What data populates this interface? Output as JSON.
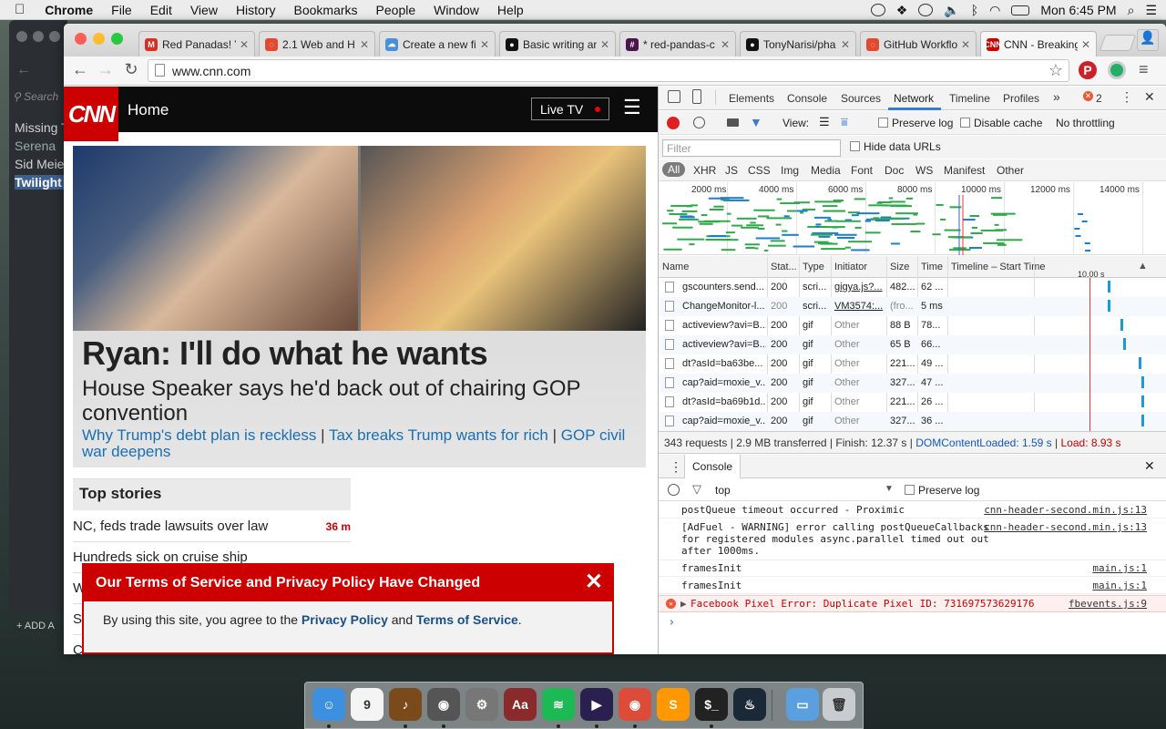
{
  "menubar": {
    "apple": "",
    "app": "Chrome",
    "items": [
      "File",
      "Edit",
      "View",
      "History",
      "Bookmarks",
      "People",
      "Window",
      "Help"
    ],
    "clock": "Mon 6:45 PM"
  },
  "bg_app": {
    "search_placeholder": "Search",
    "items": [
      "Missing T",
      "Serena",
      "Sid Meier",
      "Twilight S"
    ],
    "add_label": "ADD A"
  },
  "tabs": [
    {
      "title": "Red Panadas! Y",
      "icon": "gmail-icon",
      "color": "#d93025",
      "glyph": "M"
    },
    {
      "title": "2.1 Web and H",
      "icon": "loading-ring-icon",
      "color": "#e04a2f",
      "glyph": "◌"
    },
    {
      "title": "Create a new fi",
      "icon": "cloud-icon",
      "color": "#4a90d9",
      "glyph": "☁"
    },
    {
      "title": "Basic writing an",
      "icon": "github-icon",
      "color": "#111",
      "glyph": "●"
    },
    {
      "title": "* red-pandas-c",
      "icon": "slack-icon",
      "color": "#4a154b",
      "glyph": "#"
    },
    {
      "title": "TonyNarisi/pha",
      "icon": "github-icon",
      "color": "#111",
      "glyph": "●"
    },
    {
      "title": "GitHub Workflo",
      "icon": "loading-ring-icon",
      "color": "#e04a2f",
      "glyph": "◌"
    },
    {
      "title": "CNN - Breaking",
      "icon": "cnn-icon",
      "color": "#cc0000",
      "glyph": "CNN",
      "active": true
    }
  ],
  "address": {
    "url": "www.cnn.com"
  },
  "cnn": {
    "logo": "CNN",
    "nav_title": "Home",
    "live_tv": "Live TV",
    "headline": "Ryan: I'll do what he wants",
    "subhead": "House Speaker says he'd back out of chairing GOP convention",
    "links": [
      "Why Trump's debt plan is reckless",
      "Tax breaks Trump wants for rich",
      "GOP civil war deepens"
    ],
    "link_sep": "|",
    "top_stories_title": "Top stories",
    "stories": [
      {
        "text": "NC, feds trade lawsuits over law",
        "age": "36 m"
      },
      {
        "text": "Hundreds sick on cruise ship",
        "age": ""
      },
      {
        "text": "W",
        "age": ""
      },
      {
        "text": "S",
        "age": ""
      },
      {
        "text": "C",
        "age": ""
      }
    ],
    "tos": {
      "title": "Our Terms of Service and Privacy Policy Have Changed",
      "close": "✕",
      "body_pre": "By using this site, you agree to the ",
      "privacy": "Privacy Policy",
      "and": " and ",
      "terms": "Terms of Service",
      "end": "."
    }
  },
  "devtools": {
    "tabs": [
      "Elements",
      "Console",
      "Sources",
      "Network",
      "Timeline",
      "Profiles"
    ],
    "selected_tab": "Network",
    "more": "»",
    "error_count": "2",
    "close": "✕",
    "network_toolbar": {
      "view": "View:",
      "preserve_log": "Preserve log",
      "disable_cache": "Disable cache",
      "throttle": "No throttling"
    },
    "filter_placeholder": "Filter",
    "hide_data_urls": "Hide data URLs",
    "types": [
      "All",
      "XHR",
      "JS",
      "CSS",
      "Img",
      "Media",
      "Font",
      "Doc",
      "WS",
      "Manifest",
      "Other"
    ],
    "overview_ticks": [
      "2000 ms",
      "4000 ms",
      "6000 ms",
      "8000 ms",
      "10000 ms",
      "12000 ms",
      "14000 ms"
    ],
    "columns": [
      "Name",
      "Stat...",
      "Type",
      "Initiator",
      "Size",
      "Time",
      "Timeline – Start Time"
    ],
    "timeline_marker": "10.00 s",
    "rows": [
      {
        "name": "gscounters.send...",
        "status": "200",
        "type": "scri...",
        "initiator": "gigya.js?...",
        "size": "482...",
        "time": "62 ...",
        "link": true,
        "bar": 0.51
      },
      {
        "name": "ChangeMonitor-l...",
        "status": "200",
        "type": "scri...",
        "initiator": "VM3574:...",
        "size": "(fro...",
        "time": "5 ms",
        "link": true,
        "bar": 0.51,
        "dim": true
      },
      {
        "name": "activeview?avi=B...",
        "status": "200",
        "type": "gif",
        "initiator": "Other",
        "size": "88 B",
        "time": "78...",
        "bar": 0.55
      },
      {
        "name": "activeview?avi=B...",
        "status": "200",
        "type": "gif",
        "initiator": "Other",
        "size": "65 B",
        "time": "66...",
        "bar": 0.56
      },
      {
        "name": "dt?asId=ba63be...",
        "status": "200",
        "type": "gif",
        "initiator": "Other",
        "size": "221...",
        "time": "49 ...",
        "bar": 0.61
      },
      {
        "name": "cap?aid=moxie_v...",
        "status": "200",
        "type": "gif",
        "initiator": "Other",
        "size": "327...",
        "time": "47 ...",
        "bar": 0.62
      },
      {
        "name": "dt?asId=ba69b1d...",
        "status": "200",
        "type": "gif",
        "initiator": "Other",
        "size": "221...",
        "time": "26 ...",
        "bar": 0.62
      },
      {
        "name": "cap?aid=moxie_v...",
        "status": "200",
        "type": "gif",
        "initiator": "Other",
        "size": "327...",
        "time": "36 ...",
        "bar": 0.62
      }
    ],
    "summary": {
      "requests": "343 requests",
      "transferred": "2.9 MB transferred",
      "finish": "Finish: 12.37 s",
      "dcl": "DOMContentLoaded: 1.59 s",
      "load": "Load: 8.93 s",
      "sep": "|"
    },
    "console_tab": "Console",
    "console_context": "top",
    "console_preserve": "Preserve log",
    "console_lines": [
      {
        "text": "postQueue timeout occurred - Proximic",
        "src": "cnn-header-second.min.js:13"
      },
      {
        "text": "[AdFuel - WARNING] error calling postQueueCallbacks for registered modules async.parallel timed out out after 1000ms.",
        "src": "cnn-header-second.min.js:13"
      },
      {
        "text": "framesInit",
        "src": "main.js:1"
      },
      {
        "text": "framesInit",
        "src": "main.js:1"
      },
      {
        "text": "Facebook Pixel Error: Duplicate Pixel ID: 731697573629176",
        "src": "fbevents.js:9",
        "error": true
      }
    ],
    "prompt": "›"
  },
  "dock": {
    "items": [
      {
        "name": "finder-icon",
        "color": "#3d8fe0",
        "glyph": "☺"
      },
      {
        "name": "calendar-icon",
        "color": "#f4f4f4",
        "glyph": "9"
      },
      {
        "name": "garageband-icon",
        "color": "#7a4a1a",
        "glyph": "♪"
      },
      {
        "name": "disk-utility-icon",
        "color": "#555",
        "glyph": "◉"
      },
      {
        "name": "system-preferences-icon",
        "color": "#777",
        "glyph": "⚙"
      },
      {
        "name": "dictionary-icon",
        "color": "#8a2a2a",
        "glyph": "Aa"
      },
      {
        "name": "spotify-icon",
        "color": "#1db954",
        "glyph": "≋"
      },
      {
        "name": "video-app-icon",
        "color": "#2a2050",
        "glyph": "▶"
      },
      {
        "name": "chrome-icon",
        "color": "#dd4b39",
        "glyph": "◉"
      },
      {
        "name": "sublime-text-icon",
        "color": "#ff9800",
        "glyph": "S"
      },
      {
        "name": "terminal-icon",
        "color": "#222",
        "glyph": "$_"
      },
      {
        "name": "steam-icon",
        "color": "#1b2838",
        "glyph": "♨"
      },
      {
        "name": "downloads-folder-icon",
        "color": "#5aa0e0",
        "glyph": "▭"
      },
      {
        "name": "trash-icon",
        "color": "#c8ccd0",
        "glyph": "🗑"
      }
    ]
  }
}
